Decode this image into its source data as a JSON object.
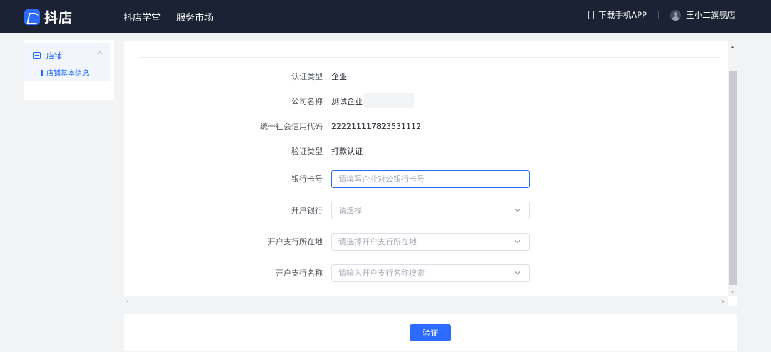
{
  "header": {
    "logo_text": "抖店",
    "nav": [
      "抖店学堂",
      "服务市场"
    ],
    "download_app": "下载手机APP",
    "user_name": "王小二旗舰店"
  },
  "sidebar": {
    "group_label": "店铺",
    "items": [
      {
        "label": "店铺基本信息",
        "active": true
      }
    ]
  },
  "form": {
    "fields": [
      {
        "label": "认证类型",
        "value": "企业"
      },
      {
        "label": "公司名称",
        "value": "测试企业"
      },
      {
        "label": "统一社会信用代码",
        "value": "222211117823531112"
      },
      {
        "label": "验证类型",
        "value": "打款认证"
      }
    ],
    "bank_card": {
      "label": "银行卡号",
      "placeholder": "请填写企业对公银行卡号"
    },
    "bank": {
      "label": "开户银行",
      "placeholder": "请选择"
    },
    "branch_location": {
      "label": "开户支行所在地",
      "placeholder": "请选择开户支行所在地"
    },
    "branch_name": {
      "label": "开户支行名称",
      "placeholder": "请输入开户支行名称搜索"
    }
  },
  "footer": {
    "verify_label": "验证"
  },
  "colors": {
    "header_bg": "#1b2233",
    "primary": "#2d6bff",
    "sidebar_active": "#1966ff",
    "page_bg": "#f2f3f5"
  }
}
